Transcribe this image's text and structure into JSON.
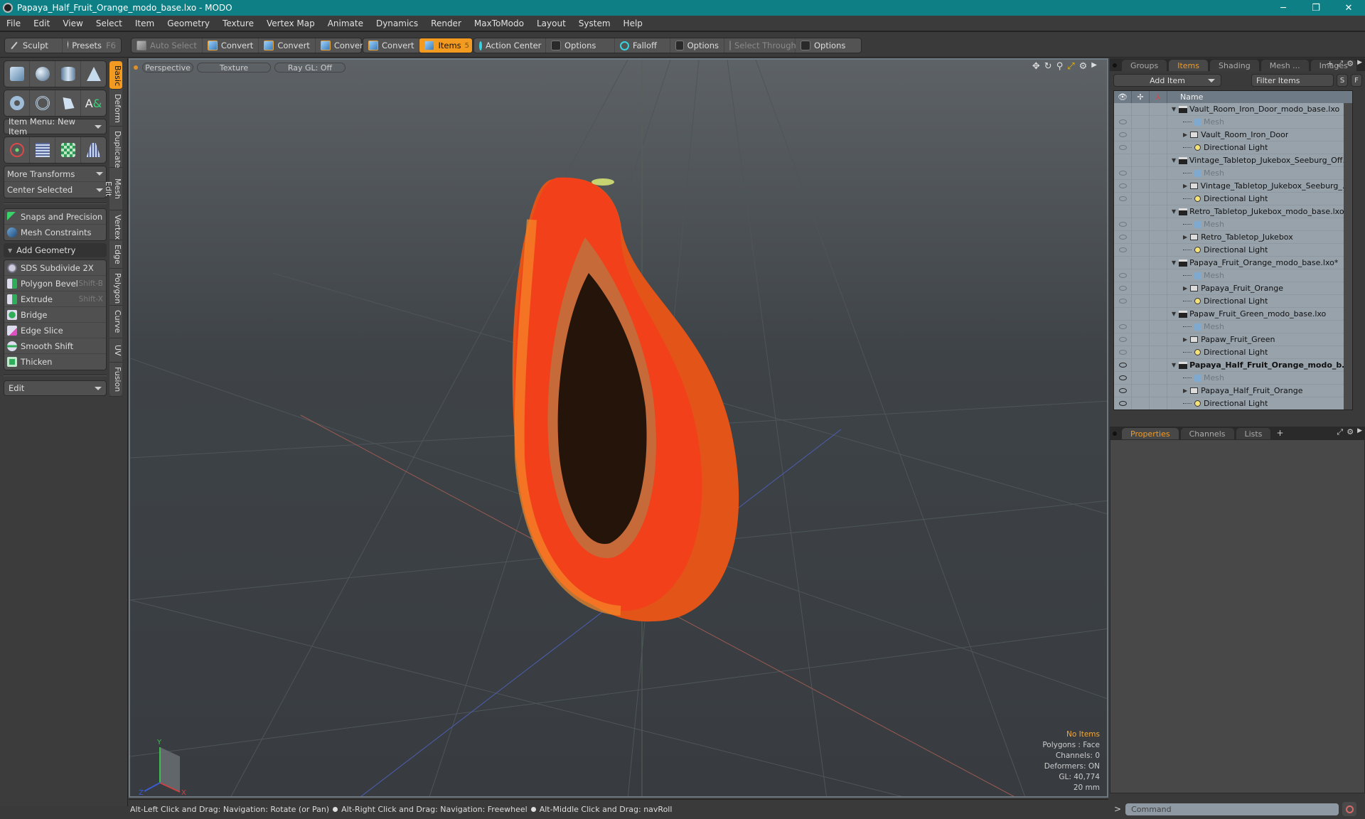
{
  "window": {
    "title": "Papaya_Half_Fruit_Orange_modo_base.lxo - MODO",
    "controls": {
      "minimize": "─",
      "restore": "❐",
      "close": "✕"
    }
  },
  "menu": [
    "File",
    "Edit",
    "View",
    "Select",
    "Item",
    "Geometry",
    "Texture",
    "Vertex Map",
    "Animate",
    "Dynamics",
    "Render",
    "MaxToModo",
    "Layout",
    "System",
    "Help"
  ],
  "toolbar": {
    "sculpt": "Sculpt",
    "presets": "Presets",
    "presets_shortcut": "F6",
    "auto_select": "Auto Select",
    "convert1": "Convert",
    "convert2": "Convert",
    "convert3": "Convert",
    "convert4": "Convert",
    "items": "Items",
    "items_count": "5",
    "action_center": "Action Center",
    "options1": "Options",
    "falloff": "Falloff",
    "options2": "Options",
    "select_through": "Select Through",
    "options3": "Options"
  },
  "left_panel": {
    "item_menu": "Item Menu: New Item",
    "more_transforms": "More Transforms",
    "center_selected": "Center Selected",
    "snaps": "Snaps and Precision",
    "mesh_constraints": "Mesh Constraints",
    "add_geometry": "Add Geometry",
    "tools": [
      {
        "label": "SDS Subdivide 2X",
        "shortcut": ""
      },
      {
        "label": "Polygon Bevel",
        "shortcut": "Shift-B"
      },
      {
        "label": "Extrude",
        "shortcut": "Shift-X"
      },
      {
        "label": "Bridge",
        "shortcut": ""
      },
      {
        "label": "Edge Slice",
        "shortcut": ""
      },
      {
        "label": "Smooth Shift",
        "shortcut": ""
      },
      {
        "label": "Thicken",
        "shortcut": ""
      }
    ],
    "edit_dropdown": "Edit",
    "vertical_tabs": [
      "Basic",
      "Deform",
      "Duplicate",
      "Mesh Edit",
      "Vertex",
      "Edge",
      "Polygon",
      "Curve",
      "UV",
      "Fusion"
    ]
  },
  "viewport": {
    "view_mode": "Perspective",
    "shading": "Texture",
    "raygl": "Ray GL: Off",
    "info": {
      "selection": "No Items",
      "polygons": "Polygons : Face",
      "channels": "Channels: 0",
      "deformers": "Deformers: ON",
      "gl": "GL: 40,774",
      "scale": "20 mm"
    },
    "axis": {
      "x": "X",
      "y": "Y",
      "z": "Z"
    }
  },
  "status_bar": {
    "hint1": "Alt-Left Click and Drag: Navigation: Rotate (or Pan)",
    "hint2": "Alt-Right Click and Drag: Navigation: Freewheel",
    "hint3": "Alt-Middle Click and Drag: navRoll"
  },
  "right_panel": {
    "tabs": [
      "Groups",
      "Items",
      "Shading",
      "Mesh ...",
      "Images"
    ],
    "active_tab": "Items",
    "add_item": "Add Item",
    "filter_placeholder": "Filter Items",
    "s_btn": "S",
    "f_btn": "F",
    "column_name": "Name",
    "tree": [
      {
        "type": "scene",
        "label": "Vault_Room_Iron_Door_modo_base.lxo",
        "bold": false,
        "eye": false
      },
      {
        "type": "mesh",
        "label": "Mesh",
        "eye": true,
        "on": false
      },
      {
        "type": "group",
        "label": "Vault_Room_Iron_Door",
        "eye": true,
        "on": false
      },
      {
        "type": "light",
        "label": "Directional Light",
        "eye": true,
        "on": false
      },
      {
        "type": "scene",
        "label": "Vintage_Tabletop_Jukebox_Seeburg_Off_ ...",
        "bold": false,
        "eye": false
      },
      {
        "type": "mesh",
        "label": "Mesh",
        "eye": true,
        "on": false
      },
      {
        "type": "group",
        "label": "Vintage_Tabletop_Jukebox_Seeburg_Of ...",
        "eye": true,
        "on": false
      },
      {
        "type": "light",
        "label": "Directional Light",
        "eye": true,
        "on": false
      },
      {
        "type": "scene",
        "label": "Retro_Tabletop_Jukebox_modo_base.lxo",
        "bold": false,
        "eye": false
      },
      {
        "type": "mesh",
        "label": "Mesh",
        "eye": true,
        "on": false
      },
      {
        "type": "group",
        "label": "Retro_Tabletop_Jukebox",
        "eye": true,
        "on": false
      },
      {
        "type": "light",
        "label": "Directional Light",
        "eye": true,
        "on": false
      },
      {
        "type": "scene",
        "label": "Papaya_Fruit_Orange_modo_base.lxo*",
        "bold": false,
        "eye": false
      },
      {
        "type": "mesh",
        "label": "Mesh",
        "eye": true,
        "on": false
      },
      {
        "type": "group",
        "label": "Papaya_Fruit_Orange",
        "eye": true,
        "on": false
      },
      {
        "type": "light",
        "label": "Directional Light",
        "eye": true,
        "on": false
      },
      {
        "type": "scene",
        "label": "Papaw_Fruit_Green_modo_base.lxo",
        "bold": false,
        "eye": false
      },
      {
        "type": "mesh",
        "label": "Mesh",
        "eye": true,
        "on": false
      },
      {
        "type": "group",
        "label": "Papaw_Fruit_Green",
        "eye": true,
        "on": false
      },
      {
        "type": "light",
        "label": "Directional Light",
        "eye": true,
        "on": false
      },
      {
        "type": "scene",
        "label": "Papaya_Half_Fruit_Orange_modo_b ...",
        "bold": true,
        "eye": true,
        "on": true
      },
      {
        "type": "mesh",
        "label": "Mesh",
        "eye": true,
        "on": true
      },
      {
        "type": "group",
        "label": "Papaya_Half_Fruit_Orange",
        "eye": true,
        "on": true
      },
      {
        "type": "light",
        "label": "Directional Light",
        "eye": true,
        "on": true
      }
    ],
    "bottom_tabs": [
      "Properties",
      "Channels",
      "Lists"
    ],
    "bottom_active": "Properties",
    "command_placeholder": "Command"
  }
}
